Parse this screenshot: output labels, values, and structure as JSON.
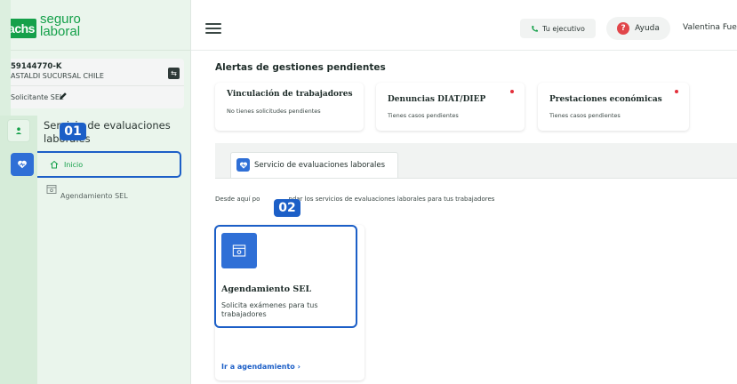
{
  "brand": {
    "logo_mark": "achs",
    "logo_text_line1": "seguro",
    "logo_text_line2": "laboral"
  },
  "company": {
    "rut": "59144770-K",
    "name": "ASTALDI SUCURSAL CHILE",
    "role": "Solicitante SEL"
  },
  "sidebar": {
    "section_title": "Servicio de evaluaciones laborales",
    "items": [
      {
        "label": "Inicio",
        "icon": "home-icon",
        "active": true
      },
      {
        "label": "Agendamiento SEL",
        "icon": "calendar-icon",
        "active": false
      }
    ]
  },
  "header": {
    "exec_label": "Tu ejecutivo",
    "help_label": "Ayuda",
    "user_name": "Valentina Fue"
  },
  "annotations": {
    "step1": "01",
    "step2": "02"
  },
  "alerts": {
    "title": "Alertas de gestiones pendientes",
    "cards": [
      {
        "title": "Vinculación de trabajadores",
        "subtitle": "No tienes solicitudes pendientes",
        "has_alert": false
      },
      {
        "title": "Denuncias DIAT/DIEP",
        "subtitle": "Tienes casos pendientes",
        "has_alert": true
      },
      {
        "title": "Prestaciones económicas",
        "subtitle": "Tienes casos pendientes",
        "has_alert": true
      }
    ]
  },
  "tabs": [
    {
      "label": "Servicio de evaluaciones laborales",
      "icon": "heart-icon"
    }
  ],
  "main": {
    "intro_visible_part1": "Desde aquí po",
    "intro_visible_part2": "ndar los servicios de evaluaciones laborales para tus trabajadores"
  },
  "service_card": {
    "title": "Agendamiento SEL",
    "description": "Solicita exámenes para tus trabajadores",
    "link_label": "Ir a agendamiento",
    "link_arrow": "›"
  },
  "colors": {
    "brand_green": "#15a04a",
    "accent_blue": "#2f6fd6",
    "annotation_blue": "#1c5fc7",
    "alert_red": "#e32f3a"
  }
}
